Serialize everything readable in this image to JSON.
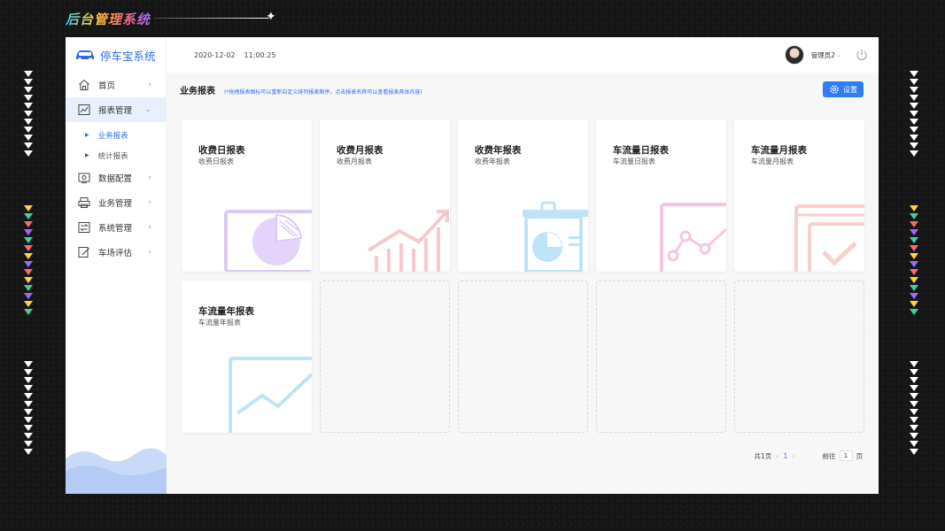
{
  "brand": {
    "title": "后台管理系统"
  },
  "app": {
    "logo": "停车宝系统",
    "date": "2020-12-02",
    "time": "11:00:25",
    "user": "管理员2"
  },
  "sidebar": {
    "items": [
      {
        "label": "首页",
        "icon": "home-icon"
      },
      {
        "label": "报表管理",
        "icon": "chart-icon"
      },
      {
        "label": "数据配置",
        "icon": "monitor-icon"
      },
      {
        "label": "业务管理",
        "icon": "printer-icon"
      },
      {
        "label": "系统管理",
        "icon": "switch-icon"
      },
      {
        "label": "车场评估",
        "icon": "edit-icon"
      }
    ],
    "subitems": [
      {
        "label": "业务报表"
      },
      {
        "label": "统计报表"
      }
    ]
  },
  "page": {
    "title": "业务报表",
    "tip": "(*拖拽报表图标可以重新自定义排列报表顺序，点击报表名称可以查看报表具体内容)",
    "settings_label": "设置"
  },
  "cards": [
    {
      "title": "收费日报表",
      "sub": "收费日报表"
    },
    {
      "title": "收费月报表",
      "sub": "收费月报表"
    },
    {
      "title": "收费年报表",
      "sub": "收费年报表"
    },
    {
      "title": "车流量日报表",
      "sub": "车流量日报表"
    },
    {
      "title": "车流量月报表",
      "sub": "车流量月报表"
    },
    {
      "title": "车流量年报表",
      "sub": "车流量年报表"
    }
  ],
  "pager": {
    "total": "共1页",
    "current": "1",
    "goto_label": "前往",
    "goto_value": "1",
    "page_unit": "页"
  },
  "colors": {
    "accent": "#2e7cf6",
    "active_bg": "#e9f0fd"
  }
}
